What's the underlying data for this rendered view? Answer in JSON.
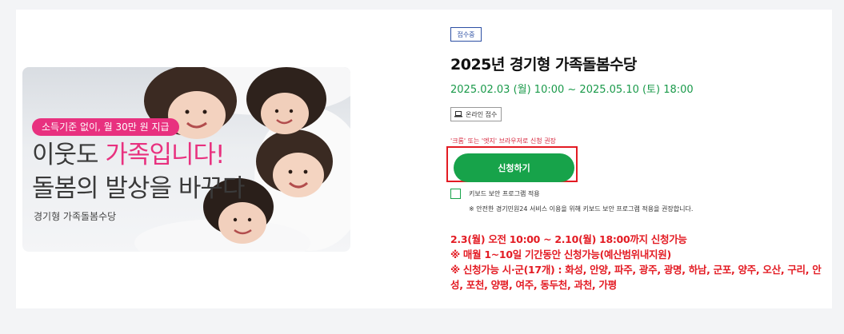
{
  "banner": {
    "tag": "소득기준 없이, 월 30만 원 지급",
    "headline_part1": "이웃도 ",
    "headline_highlight": "가족입니다!",
    "headline_line2": "돌봄의 발상을 바꾸다",
    "brand": "경기형 가족돌봄수당",
    "highlight_color": "#e8317f"
  },
  "detail": {
    "status_badge": "접수중",
    "title": "2025년 경기형 가족돌봄수당",
    "period": "2025.02.03 (월) 10:00 ~ 2025.05.10 (토) 18:00",
    "online_badge": "온라인 접수",
    "online_icon": "laptop-icon",
    "browser_note": "'크롬' 또는 '엣지' 브라우저로 신청 권장",
    "apply_label": "신청하기",
    "keyboard_label": "키보드 보안 프로그램 적용",
    "keyboard_note": "※ 안전한 경기민원24 서비스 이용을 위해 키보드 보안 프로그램 적용을 권장합니다.",
    "accent_color": "#17a34a"
  },
  "notice": {
    "line1": "2.3(월) 오전 10:00 ~ 2.10(월) 18:00까지 신청가능",
    "line2": "※ 매월 1~10일 기간동안 신청가능(예산범위내지원)",
    "line3": "※ 신청가능 시·군(17개) : 화성, 안양, 파주, 광주, 광명, 하남, 군포, 양주, 오산, 구리, 안성, 포천, 양평, 여주, 동두천, 과천, 가평",
    "color": "#e31b23"
  }
}
